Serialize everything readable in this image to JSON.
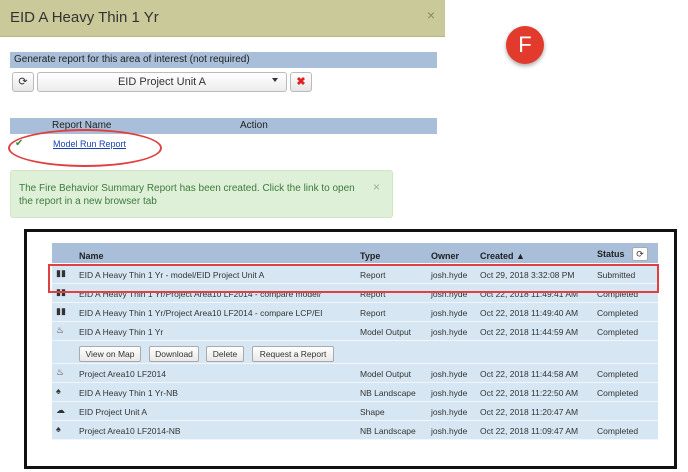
{
  "panel": {
    "title": "EID A Heavy Thin 1 Yr",
    "close": "×",
    "aoi_section_title": "Generate report for this area of interest (not required)",
    "aoi_selected": "EID Project Unit A",
    "report_col_name": "Report Name",
    "report_col_action": "Action",
    "report_link": "Model Run Report",
    "alert_text": "The Fire Behavior Summary Report has been created. Click the link to open the report in a new browser tab",
    "alert_close": "×"
  },
  "badge": {
    "letter": "F",
    "color": "#e23b2e"
  },
  "table": {
    "headers": {
      "name": "Name",
      "type": "Type",
      "owner": "Owner",
      "created": "Created",
      "status": "Status"
    },
    "rows": [
      {
        "icon": "bar-chart-icon",
        "name": "EID A Heavy Thin 1 Yr - model/EID Project Unit A",
        "type": "Report",
        "owner": "josh.hyde",
        "created": "Oct 29, 2018 3:32:08 PM",
        "status": "Submitted"
      },
      {
        "icon": "bar-chart-icon",
        "name": "EID A Heavy Thin 1 Yr/Project Area10 LF2014 - compare model/",
        "type": "Report",
        "owner": "josh.hyde",
        "created": "Oct 22, 2018 11:49:41 AM",
        "status": "Completed"
      },
      {
        "icon": "bar-chart-icon",
        "name": "EID A Heavy Thin 1 Yr/Project Area10 LF2014 - compare LCP/EI",
        "type": "Report",
        "owner": "josh.hyde",
        "created": "Oct 22, 2018 11:49:40 AM",
        "status": "Completed"
      },
      {
        "icon": "fire-icon",
        "name": "EID A Heavy Thin 1 Yr",
        "type": "Model Output",
        "owner": "josh.hyde",
        "created": "Oct 22, 2018 11:44:59 AM",
        "status": "Completed"
      },
      {
        "icon": "fire-icon",
        "name": "Project Area10 LF2014",
        "type": "Model Output",
        "owner": "josh.hyde",
        "created": "Oct 22, 2018 11:44:58 AM",
        "status": "Completed"
      },
      {
        "icon": "tree-icon",
        "name": "EID A Heavy Thin 1 Yr-NB",
        "type": "NB Landscape",
        "owner": "josh.hyde",
        "created": "Oct 22, 2018 11:22:50 AM",
        "status": "Completed"
      },
      {
        "icon": "cloud-icon",
        "name": "EID Project Unit A",
        "type": "Shape",
        "owner": "josh.hyde",
        "created": "Oct 22, 2018 11:20:47 AM",
        "status": ""
      },
      {
        "icon": "tree-icon",
        "name": "Project Area10 LF2014-NB",
        "type": "NB Landscape",
        "owner": "josh.hyde",
        "created": "Oct 22, 2018 11:09:47 AM",
        "status": "Completed"
      }
    ],
    "actions": {
      "view": "View on Map",
      "download": "Download",
      "delete": "Delete",
      "request": "Request a Report"
    }
  }
}
